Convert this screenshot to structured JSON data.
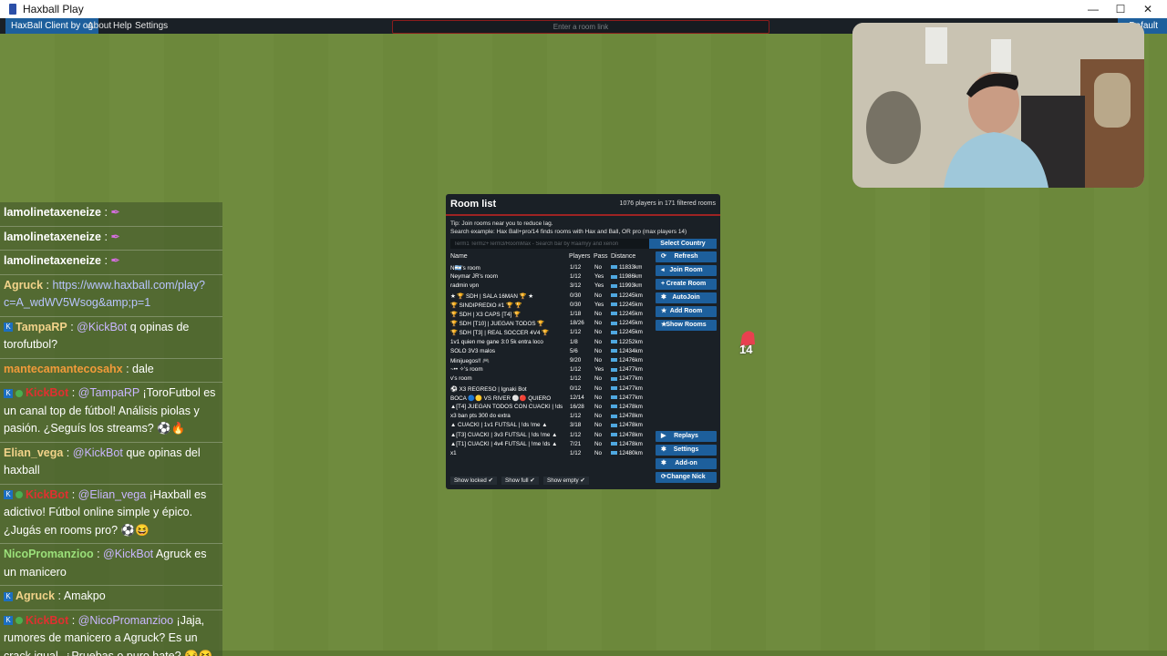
{
  "window": {
    "title": "Haxball Play",
    "minimize": "—",
    "maximize": "☐",
    "close": "✕"
  },
  "menu": {
    "brand": "HaxBall Client by og",
    "about": "About",
    "help": "Help",
    "settings": "Settings",
    "default_btn": "Default"
  },
  "link_input": {
    "placeholder": "Enter a room link"
  },
  "chat": {
    "messages": [
      {
        "user": "lamolinetaxeneize",
        "text": "",
        "user_color": "#ffffff"
      },
      {
        "user": "lamolinetaxeneize",
        "text": "",
        "user_color": "#ffffff"
      },
      {
        "user": "lamolinetaxeneize",
        "text": "",
        "user_color": "#ffffff"
      },
      {
        "user": "Agruck",
        "text": "https://www.haxball.com/play?c=A_wdWV5Wsog&amp;p=1",
        "user_color": "#f2d38a"
      },
      {
        "user": "TampaRP",
        "mention": "@KickBot",
        "text": "q opinas de torofutbol?",
        "user_color": "#f2d38a"
      },
      {
        "user": "mantecamantecosahx",
        "text": "dale",
        "user_color": "#f29b3a"
      },
      {
        "user": "KickBot",
        "mention": "@TampaRP",
        "text": "¡ToroFutbol es un canal top de fútbol! Análisis piolas y pasión. ¿Seguís los streams? ⚽🔥",
        "user_color": "#e03030"
      },
      {
        "user": "Elian_vega",
        "mention": "@KickBot",
        "text": "que opinas del haxball",
        "user_color": "#f2d38a"
      },
      {
        "user": "KickBot",
        "mention": "@Elian_vega",
        "text": "¡Haxball es adictivo! Fútbol online simple y épico. ¿Jugás en rooms pro? ⚽😆",
        "user_color": "#e03030"
      },
      {
        "user": "NicoPromanzioo",
        "mention": "@KickBot",
        "text": "Agruck es un manicero",
        "user_color": "#9be07a"
      },
      {
        "user": "Agruck",
        "text": "Amakpo",
        "user_color": "#f2d38a"
      },
      {
        "user": "KickBot",
        "mention": "@NicoPromanzioo",
        "text": "¡Jaja, rumores de manicero a Agruck? Es un crack igual. ¿Pruebas o puro hate? 😏😆",
        "user_color": "#e03030"
      }
    ]
  },
  "room_list": {
    "title": "Room list",
    "count": "1076 players in 171 filtered rooms",
    "tip": "Tip: Join rooms near you to reduce lag.",
    "search_example": "Search example: Hax Ball+pro/14 finds rooms with Hax and Ball, OR pro (max players 14)",
    "search_placeholder": "Term1 Term2+Term3/RoomMax - Search bar by Raamyy and xenon",
    "select_country": "Select Country",
    "columns": {
      "name": "Name",
      "players": "Players",
      "pass": "Pass",
      "distance": "Distance"
    },
    "rooms": [
      {
        "name": "N🇦🇷's room",
        "players": "1/12",
        "pass": "No",
        "distance": "11833km"
      },
      {
        "name": "Neymar JR's room",
        "players": "1/12",
        "pass": "Yes",
        "distance": "11986km"
      },
      {
        "name": "radmin vpn",
        "players": "3/12",
        "pass": "Yes",
        "distance": "11993km"
      },
      {
        "name": "★ 🏆 SDH | SALA 16MAN 🏆 ★",
        "players": "0/30",
        "pass": "No",
        "distance": "12245km"
      },
      {
        "name": "🏆 SINDIPREDIO #1 🏆 🏆",
        "players": "0/30",
        "pass": "Yes",
        "distance": "12245km"
      },
      {
        "name": "🏆 SDH | X3 CAPS [T4] 🏆",
        "players": "1/18",
        "pass": "No",
        "distance": "12245km"
      },
      {
        "name": "🏆 SDH [T10] | JUEGAN TODOS 🏆",
        "players": "18/26",
        "pass": "No",
        "distance": "12245km"
      },
      {
        "name": "🏆 SDH [T3] | REAL SOCCER 4V4 🏆",
        "players": "1/12",
        "pass": "No",
        "distance": "12245km"
      },
      {
        "name": "1v1 quien me gane 3:0 5k entra loco",
        "players": "1/8",
        "pass": "No",
        "distance": "12252km"
      },
      {
        "name": "SOLO 3V3 malos",
        "players": "5/6",
        "pass": "No",
        "distance": "12434km"
      },
      {
        "name": "Minijuegos!! 🎮",
        "players": "9/20",
        "pass": "No",
        "distance": "12476km"
      },
      {
        "name": "~•• ✧'s room",
        "players": "1/12",
        "pass": "Yes",
        "distance": "12477km"
      },
      {
        "name": "v's room",
        "players": "1/12",
        "pass": "No",
        "distance": "12477km"
      },
      {
        "name": "⚽ X3 REGRESO | Ignaki Bot",
        "players": "0/12",
        "pass": "No",
        "distance": "12477km"
      },
      {
        "name": "BOCA 🔵🟡 VS RIVER ⚪🔴 QUIERO",
        "players": "12/14",
        "pass": "No",
        "distance": "12477km"
      },
      {
        "name": "▲[T4] JUEGAN TODOS CON CUACKI | !ds",
        "players": "16/28",
        "pass": "No",
        "distance": "12478km"
      },
      {
        "name": "x3 ban pts 300 do extra",
        "players": "1/12",
        "pass": "No",
        "distance": "12478km"
      },
      {
        "name": "▲ CUACKI | 1v1 FUTSAL | !ds !me ▲",
        "players": "3/18",
        "pass": "No",
        "distance": "12478km"
      },
      {
        "name": "▲[T3] CUACKI | 3v3 FUTSAL | !ds !me ▲",
        "players": "1/12",
        "pass": "No",
        "distance": "12478km"
      },
      {
        "name": "▲[T1] CUACKI | 4v4 FUTSAL | !me !ds ▲",
        "players": "7/21",
        "pass": "No",
        "distance": "12478km"
      },
      {
        "name": "x1",
        "players": "1/12",
        "pass": "No",
        "distance": "12480km"
      }
    ],
    "buttons": {
      "refresh": "Refresh",
      "join": "Join Room",
      "create": "Create Room",
      "autojoin": "AutoJoin",
      "add": "Add Room",
      "show": "Show Rooms",
      "replays": "Replays",
      "settings": "Settings",
      "addon": "Add-on",
      "nick": "Change Nick"
    },
    "checks": {
      "locked": "Show locked ✔",
      "full": "Show full ✔",
      "empty": "Show empty ✔"
    }
  },
  "player": {
    "number": "14",
    "color": "#e8404f"
  },
  "colors": {
    "accent": "#1d5f9c",
    "panel": "#1a2026",
    "field": "#6f8b3e",
    "panel_border": "#9e2323"
  }
}
